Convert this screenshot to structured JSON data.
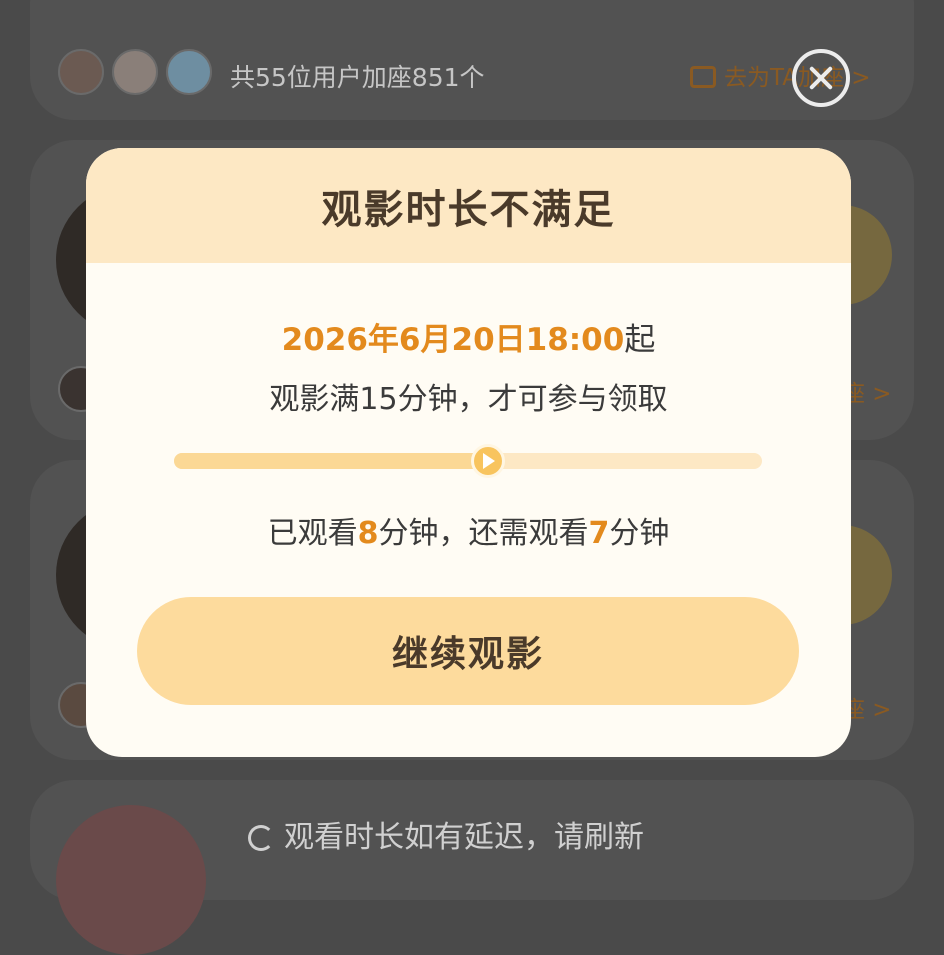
{
  "background": {
    "card1": {
      "summary_text": "共55位用户加座851个",
      "link_text": "去为TA加座 >"
    },
    "card2": {
      "link_text": "座 >"
    },
    "card3": {
      "link_text": "座 >"
    },
    "footer_text": "观看时长如有延迟，请刷新"
  },
  "modal": {
    "title": "观影时长不满足",
    "date_highlight": "2026年6月20日18:00",
    "date_suffix": "起",
    "rule_text": "观影满15分钟，才可参与领取",
    "progress": {
      "watched_minutes": 8,
      "required_minutes": 15
    },
    "status": {
      "watched_prefix": "已观看",
      "watched_value": "8",
      "watched_unit": "分钟，还需观看",
      "remaining_value": "7",
      "remaining_unit": "分钟"
    },
    "continue_label": "继续观影"
  },
  "colors": {
    "accent": "#e38a1d",
    "header_bg": "#fde8c4",
    "button_bg": "#fddb9d",
    "overlay": "#4a4a4a"
  },
  "icons": {
    "close": "close-icon",
    "play": "play-icon",
    "seat": "seat-icon",
    "refresh": "refresh-icon"
  }
}
